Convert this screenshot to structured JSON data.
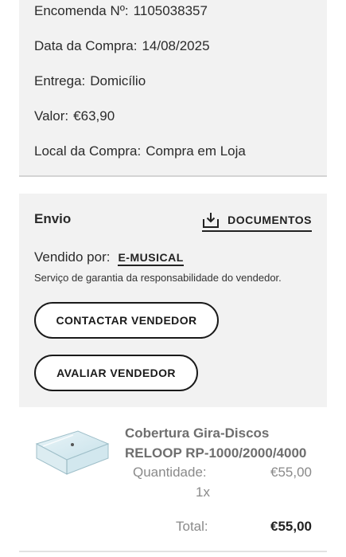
{
  "order": {
    "number_label": "Encomenda Nº:",
    "number_value": "1105038357",
    "date_label": "Data da Compra:",
    "date_value": "14/08/2025",
    "delivery_label": "Entrega:",
    "delivery_value": "Domicílio",
    "value_label": "Valor:",
    "value_value": "€63,90",
    "place_label": "Local da Compra:",
    "place_value": "Compra em Loja"
  },
  "shipping": {
    "title": "Envio",
    "documents_label": "DOCUMENTOS",
    "documents_icon": "download-tray-icon",
    "sold_by_label": "Vendido por:",
    "seller_name": "E-MUSICAL",
    "warranty_text": "Serviço de garantia da responsabilidade do vendedor.",
    "contact_button": "CONTACTAR VENDEDOR",
    "rate_button": "AVALIAR VENDEDOR"
  },
  "product": {
    "name": "Cobertura Gira-Discos RELOOP RP-1000/2000/4000",
    "quantity_label": "Quantidade:",
    "quantity_value": "1x",
    "unit_price": "€55,00",
    "total_label": "Total:",
    "total_value": "€55,00",
    "image_icon": "turntable-cover-image"
  }
}
